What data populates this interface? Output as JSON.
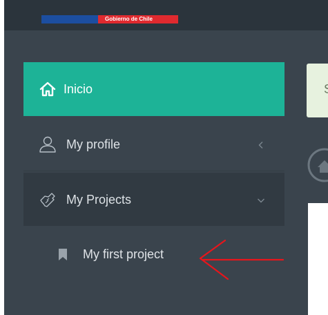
{
  "header": {
    "gov_label": "Gobierno de Chile",
    "colors": {
      "bar": "#2b343c",
      "flag_blue": "#1c4ea0",
      "flag_red": "#e02a2f"
    }
  },
  "sidebar": {
    "items": [
      {
        "label": "Inicio",
        "icon": "home-icon",
        "active": true
      },
      {
        "label": "My profile",
        "icon": "user-icon",
        "chevron": "chevron-left-icon"
      },
      {
        "label": "My Projects",
        "icon": "handshake-icon",
        "chevron": "chevron-down-icon",
        "expanded": true
      }
    ],
    "subitems": [
      {
        "label": "My first project",
        "icon": "bookmark-icon"
      }
    ],
    "colors": {
      "background": "#3a444d",
      "active": "#1db397",
      "expanded": "#313a42"
    }
  },
  "annotation": {
    "icon": "red-arrow-icon",
    "color": "#e8151b"
  },
  "main": {
    "alert_text": "S",
    "alert_color": "#e7f2df",
    "breadcrumb_icon": "home-circle-icon"
  }
}
